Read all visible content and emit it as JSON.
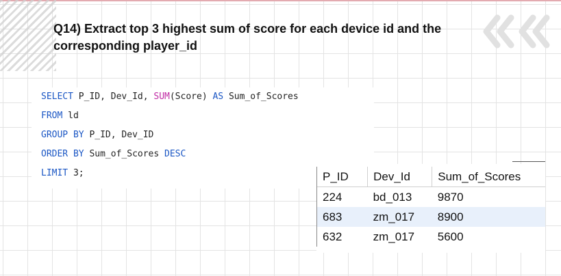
{
  "question": {
    "title": "Q14) Extract top 3 highest sum of score for each device id and the corresponding player_id"
  },
  "query": {
    "select_kw": "SELECT",
    "select_cols_a": "P_ID, Dev_Id,",
    "sum_fn": "SUM",
    "sum_args": "(Score)",
    "as_kw": "AS",
    "alias": "Sum_of_Scores",
    "from_kw": "FROM",
    "table": "ld",
    "groupby_kw": "GROUP BY",
    "groupby_cols": "P_ID, Dev_ID",
    "orderby_kw": "ORDER BY",
    "orderby_col": "Sum_of_Scores",
    "desc_kw": "DESC",
    "limit_kw": "LIMIT",
    "limit_val": "3",
    "limit_end": ";"
  },
  "results": {
    "columns": [
      "P_ID",
      "Dev_Id",
      "Sum_of_Scores"
    ],
    "rows": [
      [
        "224",
        "bd_013",
        "9870"
      ],
      [
        "683",
        "zm_017",
        "8900"
      ],
      [
        "632",
        "zm_017",
        "5600"
      ]
    ]
  },
  "colors": {
    "keyword": "#1a56c4",
    "function": "#c02aa4",
    "selected_row": "#e8f0fb"
  },
  "icons": [
    "hatch-pattern",
    "double-chevron-left-icon"
  ]
}
